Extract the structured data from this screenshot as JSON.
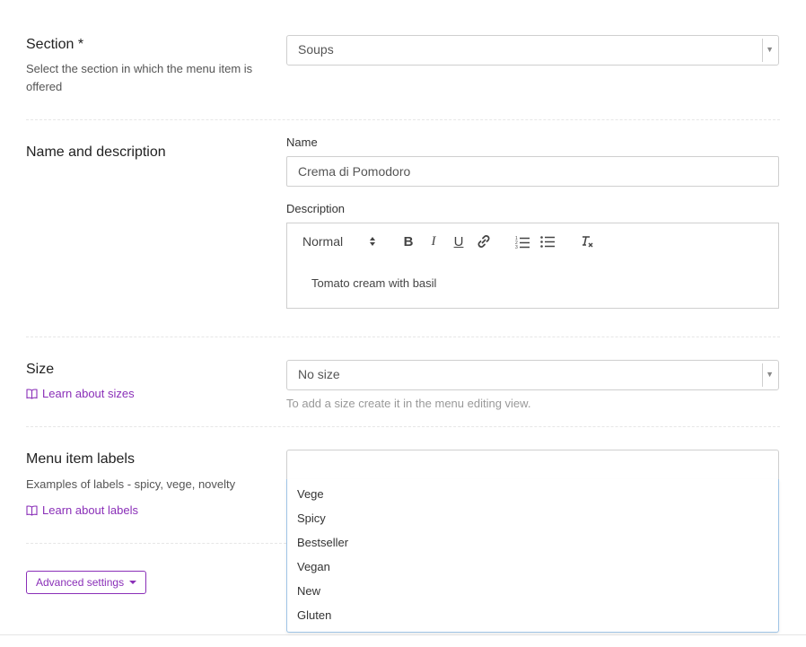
{
  "section": {
    "title": "Section *",
    "help": "Select the section in which the menu item is offered",
    "selected": "Soups"
  },
  "name_desc": {
    "title": "Name and description",
    "name_label": "Name",
    "name_value": "Crema di Pomodoro",
    "description_label": "Description",
    "format_select": "Normal",
    "description_text": "Tomato cream with basil"
  },
  "size": {
    "title": "Size",
    "link": "Learn about sizes",
    "selected": "No size",
    "hint": "To add a size create it in the menu editing view."
  },
  "labels": {
    "title": "Menu item labels",
    "help": "Examples of labels - spicy, vege, novelty",
    "link": "Learn about labels",
    "options": [
      "Vege",
      "Spicy",
      "Bestseller",
      "Vegan",
      "New",
      "Gluten"
    ]
  },
  "advanced_button": "Advanced settings",
  "colors": {
    "accent": "#8a2fb8",
    "focus_border": "#9fc4e6"
  }
}
